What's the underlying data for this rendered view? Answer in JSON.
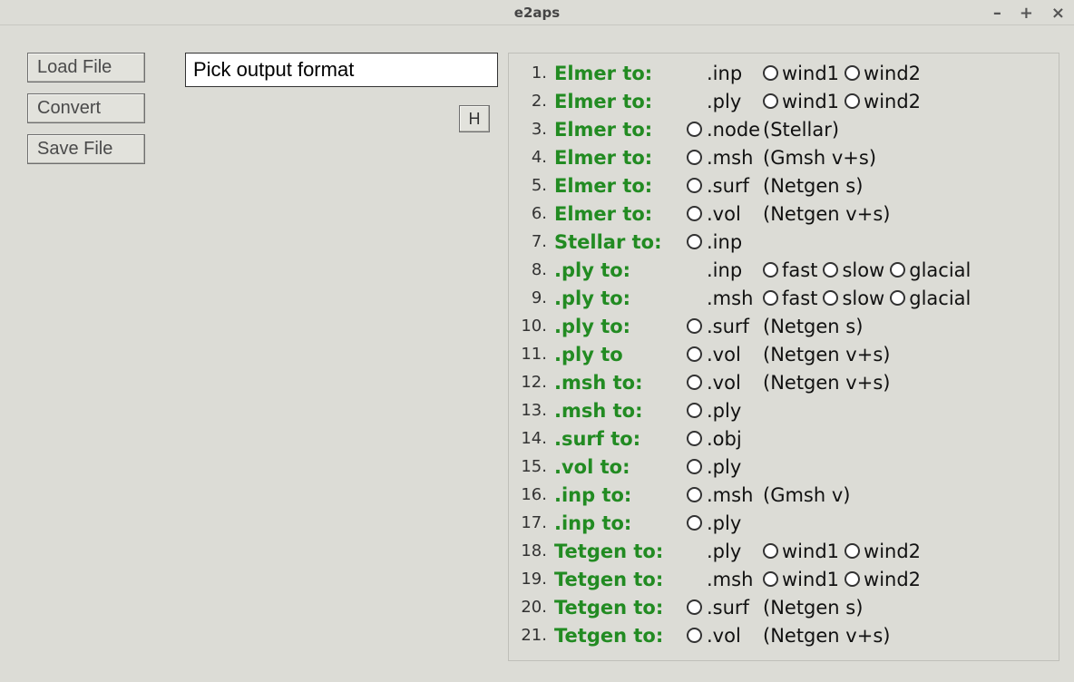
{
  "window": {
    "title": "e2aps"
  },
  "buttons": {
    "load": "Load File",
    "convert": "Convert",
    "save": "Save File",
    "help": "H"
  },
  "format_input": {
    "value": "Pick output format"
  },
  "rows": [
    {
      "n": "1.",
      "label": "Elmer to:",
      "radio": false,
      "ext": ".inp",
      "opts": [
        "wind1",
        "wind2"
      ]
    },
    {
      "n": "2.",
      "label": "Elmer to:",
      "radio": false,
      "ext": ".ply",
      "opts": [
        "wind1",
        "wind2"
      ]
    },
    {
      "n": "3.",
      "label": "Elmer to:",
      "radio": true,
      "ext": ".node",
      "desc": "(Stellar)"
    },
    {
      "n": "4.",
      "label": "Elmer to:",
      "radio": true,
      "ext": ".msh",
      "desc": "(Gmsh v+s)"
    },
    {
      "n": "5.",
      "label": "Elmer to:",
      "radio": true,
      "ext": ".surf",
      "desc": "(Netgen s)"
    },
    {
      "n": "6.",
      "label": "Elmer to:",
      "radio": true,
      "ext": ".vol",
      "desc": "(Netgen v+s)"
    },
    {
      "n": "7.",
      "label": "Stellar to:",
      "radio": true,
      "ext": ".inp",
      "desc": ""
    },
    {
      "n": "8.",
      "label": ".ply to:",
      "radio": false,
      "ext": ".inp",
      "opts": [
        "fast",
        "slow",
        "glacial"
      ]
    },
    {
      "n": "9.",
      "label": ".ply to:",
      "radio": false,
      "ext": ".msh",
      "opts": [
        "fast",
        "slow",
        "glacial"
      ]
    },
    {
      "n": "10.",
      "label": ".ply to:",
      "radio": true,
      "ext": ".surf",
      "desc": "(Netgen s)"
    },
    {
      "n": "11.",
      "label": ".ply to",
      "radio": true,
      "ext": ".vol",
      "desc": "(Netgen v+s)"
    },
    {
      "n": "12.",
      "label": ".msh to:",
      "radio": true,
      "ext": ".vol",
      "desc": "(Netgen v+s)"
    },
    {
      "n": "13.",
      "label": ".msh to:",
      "radio": true,
      "ext": ".ply",
      "desc": ""
    },
    {
      "n": "14.",
      "label": ".surf to:",
      "radio": true,
      "ext": ".obj",
      "desc": ""
    },
    {
      "n": "15.",
      "label": ".vol to:",
      "radio": true,
      "ext": ".ply",
      "desc": ""
    },
    {
      "n": "16.",
      "label": ".inp to:",
      "radio": true,
      "ext": ".msh",
      "desc": "(Gmsh v)"
    },
    {
      "n": "17.",
      "label": ".inp to:",
      "radio": true,
      "ext": ".ply",
      "desc": ""
    },
    {
      "n": "18.",
      "label": "Tetgen to:",
      "radio": false,
      "ext": ".ply",
      "opts": [
        "wind1",
        "wind2"
      ]
    },
    {
      "n": "19.",
      "label": "Tetgen to:",
      "radio": false,
      "ext": ".msh",
      "opts": [
        "wind1",
        "wind2"
      ]
    },
    {
      "n": "20.",
      "label": "Tetgen to:",
      "radio": true,
      "ext": ".surf",
      "desc": "(Netgen s)"
    },
    {
      "n": "21.",
      "label": "Tetgen to:",
      "radio": true,
      "ext": ".vol",
      "desc": "(Netgen v+s)"
    }
  ]
}
